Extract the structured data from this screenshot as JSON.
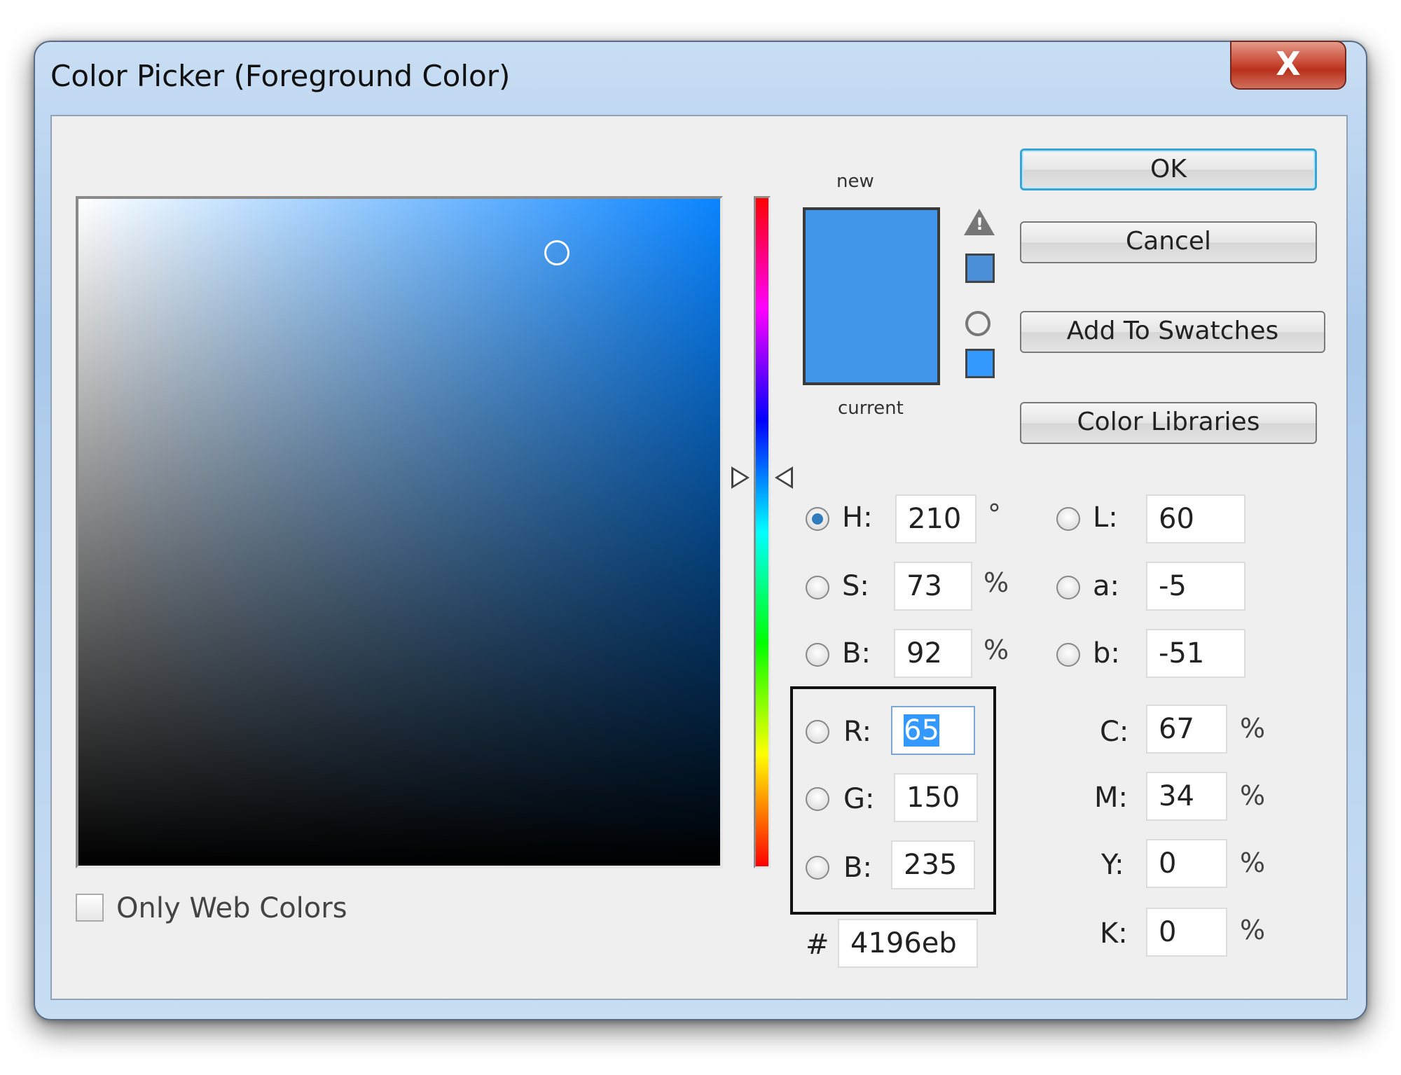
{
  "window": {
    "title": "Color Picker (Foreground Color)",
    "close_label": "X"
  },
  "swatch": {
    "new_label": "new",
    "current_label": "current",
    "new_color": "#4196eb",
    "current_color": "#4196eb",
    "web_safe_color": "#3399ff",
    "gamut_color": "#4a8fd8"
  },
  "buttons": {
    "ok": "OK",
    "cancel": "Cancel",
    "add_to_swatches": "Add To Swatches",
    "color_libraries": "Color Libraries"
  },
  "hsb": {
    "h": {
      "label": "H:",
      "value": "210",
      "unit": "°"
    },
    "s": {
      "label": "S:",
      "value": "73",
      "unit": "%"
    },
    "b": {
      "label": "B:",
      "value": "92",
      "unit": "%"
    }
  },
  "lab": {
    "l": {
      "label": "L:",
      "value": "60"
    },
    "a": {
      "label": "a:",
      "value": "-5"
    },
    "b": {
      "label": "b:",
      "value": "-51"
    }
  },
  "rgb": {
    "r": {
      "label": "R:",
      "value": "65"
    },
    "g": {
      "label": "G:",
      "value": "150"
    },
    "b": {
      "label": "B:",
      "value": "235"
    }
  },
  "cmyk": {
    "c": {
      "label": "C:",
      "value": "67",
      "unit": "%"
    },
    "m": {
      "label": "M:",
      "value": "34",
      "unit": "%"
    },
    "y": {
      "label": "Y:",
      "value": "0",
      "unit": "%"
    },
    "k": {
      "label": "K:",
      "value": "0",
      "unit": "%"
    }
  },
  "hex": {
    "label": "#",
    "value": "4196eb"
  },
  "only_web_colors": {
    "label": "Only Web Colors",
    "checked": false
  },
  "selected_channel": "H"
}
